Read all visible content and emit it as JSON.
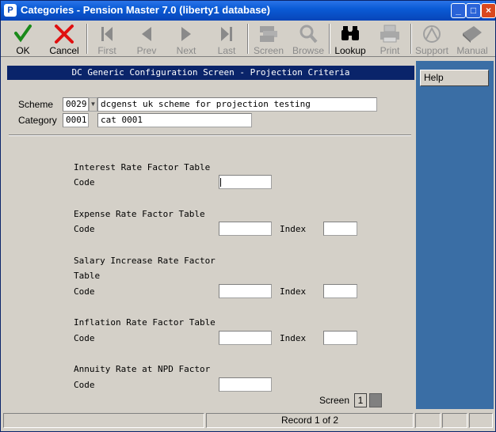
{
  "window": {
    "title": "Categories - Pension Master 7.0 (liberty1 database)",
    "app_icon": "pension-master-icon"
  },
  "toolbar": {
    "items": [
      {
        "label": "OK",
        "icon": "check-icon",
        "enabled": true,
        "color": "#1a8a1a"
      },
      {
        "label": "Cancel",
        "icon": "cross-icon",
        "enabled": true,
        "color": "#e01010"
      },
      {
        "label": "First",
        "icon": "first-icon",
        "enabled": false
      },
      {
        "label": "Prev",
        "icon": "prev-icon",
        "enabled": false
      },
      {
        "label": "Next",
        "icon": "next-icon",
        "enabled": false
      },
      {
        "label": "Last",
        "icon": "last-icon",
        "enabled": false
      },
      {
        "label": "Screen",
        "icon": "screen-icon",
        "enabled": false
      },
      {
        "label": "Browse",
        "icon": "magnifier-icon",
        "enabled": false
      },
      {
        "label": "Lookup",
        "icon": "binoculars-icon",
        "enabled": true
      },
      {
        "label": "Print",
        "icon": "printer-icon",
        "enabled": false
      },
      {
        "label": "Support",
        "icon": "support-icon",
        "enabled": false
      },
      {
        "label": "Manual",
        "icon": "book-icon",
        "enabled": false
      }
    ]
  },
  "header": {
    "title": "DC Generic Configuration Screen - Projection Criteria"
  },
  "scheme": {
    "label": "Scheme",
    "code": "0029",
    "description": "dcgenst uk scheme for projection testing"
  },
  "category": {
    "label": "Category",
    "code": "0001",
    "description": "cat 0001"
  },
  "sections": {
    "interest": {
      "title": "Interest Rate Factor Table",
      "code_label": "Code",
      "code_value": ""
    },
    "expense": {
      "title": "Expense Rate Factor Table",
      "code_label": "Code",
      "code_value": "",
      "index_label": "Index",
      "index_value": ""
    },
    "salary": {
      "title_line1": "Salary Increase Rate Factor",
      "title_line2": "Table",
      "code_label": "Code",
      "code_value": "",
      "index_label": "Index",
      "index_value": ""
    },
    "inflation": {
      "title": "Inflation Rate Factor Table",
      "code_label": "Code",
      "code_value": "",
      "index_label": "Index",
      "index_value": ""
    },
    "annuity": {
      "title": "Annuity Rate at NPD Factor",
      "code_label": "Code",
      "code_value": ""
    }
  },
  "pager": {
    "label": "Screen",
    "current": "1"
  },
  "sidebar": {
    "help_label": "Help"
  },
  "statusbar": {
    "record": "Record 1 of 2"
  },
  "colors": {
    "header_bg": "#0a246a",
    "sidebar_bg": "#3a6ea5",
    "title_bar": "#0a5bd6"
  }
}
